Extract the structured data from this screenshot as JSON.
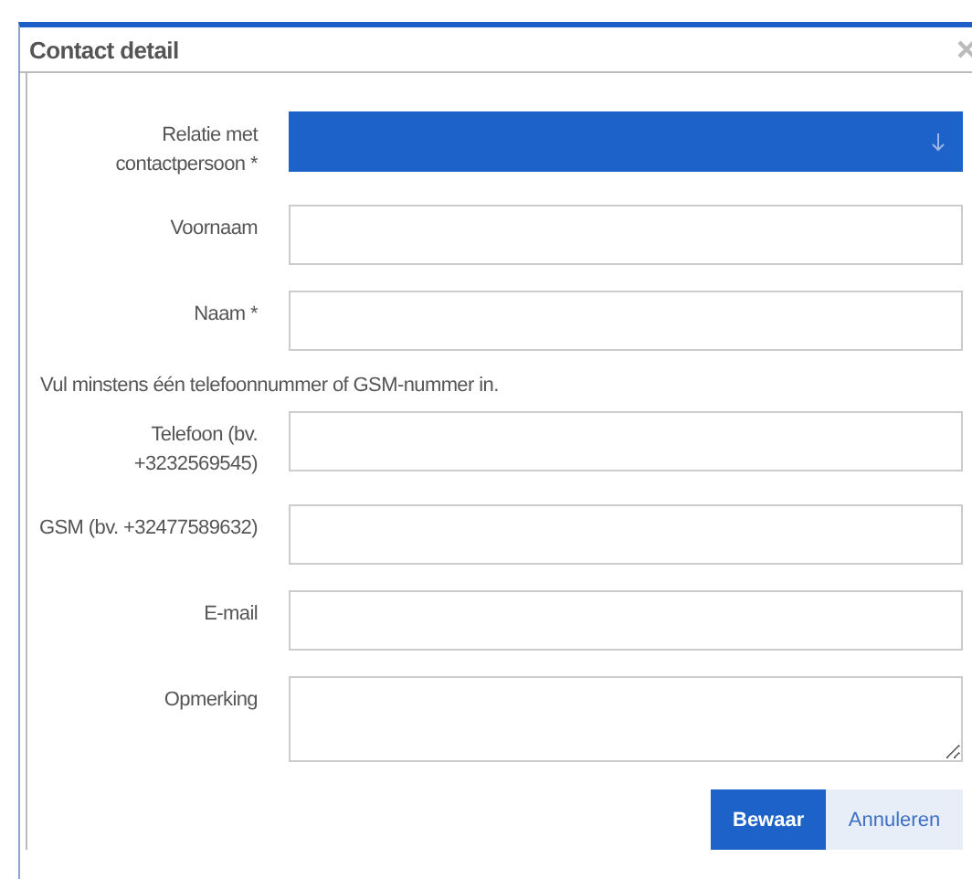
{
  "dialog": {
    "title": "Contact detail"
  },
  "fields": [
    {
      "kind": "select",
      "label": "Relatie met contactpersoon *"
    },
    {
      "kind": "text",
      "label": "Voornaam"
    },
    {
      "kind": "text",
      "label": "Naam *"
    },
    {
      "kind": "note",
      "label": "Vul minstens één telefoonnummer of GSM-nummer in."
    },
    {
      "kind": "text",
      "label": "Telefoon (bv. +3232569545)"
    },
    {
      "kind": "text",
      "label": "GSM (bv. +32477589632)"
    },
    {
      "kind": "text",
      "label": "E-mail"
    },
    {
      "kind": "textarea",
      "label": "Opmerking"
    }
  ],
  "buttons": [
    {
      "label": "Bewaar",
      "kind": "primary"
    },
    {
      "label": "Annuleren",
      "kind": "secondary"
    }
  ]
}
